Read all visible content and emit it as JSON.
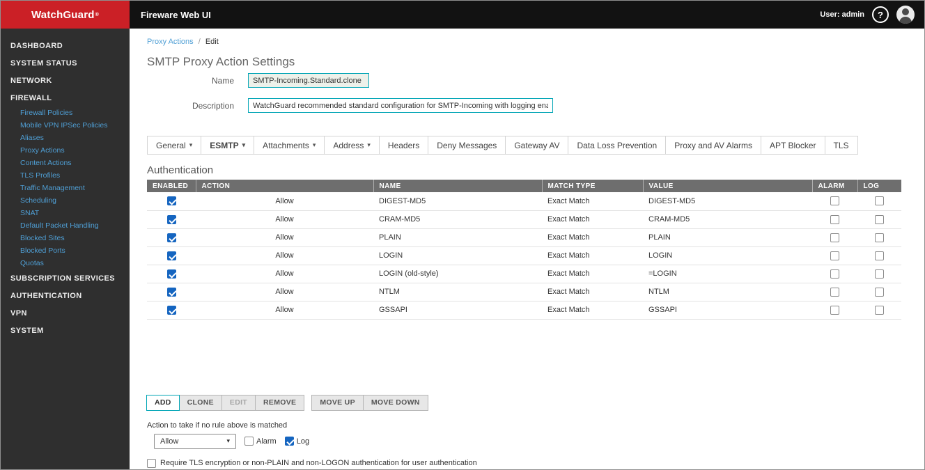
{
  "colors": {
    "brand-red": "#cb2026",
    "topbar-bg": "#121212",
    "sidebar-bg": "#2f2f2f",
    "link-blue": "#4f9fd5",
    "accent": "#00a5b5",
    "table-header-bg": "#6e6e6e",
    "check-blue": "#1565c0"
  },
  "icons": {
    "chevron_down": "▾",
    "help": "?"
  },
  "topbar": {
    "brand": "WatchGuard",
    "brand_reg": "®",
    "title": "Fireware Web UI",
    "user": "User: admin"
  },
  "sidebar": {
    "items": [
      {
        "label": "DASHBOARD"
      },
      {
        "label": "SYSTEM STATUS"
      },
      {
        "label": "NETWORK"
      },
      {
        "label": "FIREWALL",
        "children": [
          "Firewall Policies",
          "Mobile VPN IPSec Policies",
          "Aliases",
          "Proxy Actions",
          "Content Actions",
          "TLS Profiles",
          "Traffic Management",
          "Scheduling",
          "SNAT",
          "Default Packet Handling",
          "Blocked Sites",
          "Blocked Ports",
          "Quotas"
        ]
      },
      {
        "label": "SUBSCRIPTION SERVICES"
      },
      {
        "label": "AUTHENTICATION"
      },
      {
        "label": "VPN"
      },
      {
        "label": "SYSTEM"
      }
    ]
  },
  "breadcrumb": {
    "link": "Proxy Actions",
    "separator": "/",
    "current": "Edit"
  },
  "page": {
    "title": "SMTP Proxy Action Settings",
    "name_label": "Name",
    "name_value": "SMTP-Incoming.Standard.clone",
    "description_label": "Description",
    "description_value": "WatchGuard recommended standard configuration for SMTP-Incoming with logging enabled"
  },
  "tabs": [
    {
      "label": "General",
      "dropdown": true
    },
    {
      "label": "ESMTP",
      "dropdown": true,
      "active": true
    },
    {
      "label": "Attachments",
      "dropdown": true
    },
    {
      "label": "Address",
      "dropdown": true
    },
    {
      "label": "Headers"
    },
    {
      "label": "Deny Messages"
    },
    {
      "label": "Gateway AV"
    },
    {
      "label": "Data Loss Prevention"
    },
    {
      "label": "Proxy and AV Alarms"
    },
    {
      "label": "APT Blocker"
    },
    {
      "label": "TLS"
    }
  ],
  "section": {
    "title": "Authentication"
  },
  "table": {
    "headers": [
      "ENABLED",
      "ACTION",
      "NAME",
      "MATCH TYPE",
      "VALUE",
      "ALARM",
      "LOG"
    ],
    "rows": [
      {
        "enabled": true,
        "action": "Allow",
        "name": "DIGEST-MD5",
        "match_type": "Exact Match",
        "value": "DIGEST-MD5",
        "alarm": false,
        "log": false
      },
      {
        "enabled": true,
        "action": "Allow",
        "name": "CRAM-MD5",
        "match_type": "Exact Match",
        "value": "CRAM-MD5",
        "alarm": false,
        "log": false
      },
      {
        "enabled": true,
        "action": "Allow",
        "name": "PLAIN",
        "match_type": "Exact Match",
        "value": "PLAIN",
        "alarm": false,
        "log": false
      },
      {
        "enabled": true,
        "action": "Allow",
        "name": "LOGIN",
        "match_type": "Exact Match",
        "value": "LOGIN",
        "alarm": false,
        "log": false
      },
      {
        "enabled": true,
        "action": "Allow",
        "name": "LOGIN (old-style)",
        "match_type": "Exact Match",
        "value": "=LOGIN",
        "alarm": false,
        "log": false
      },
      {
        "enabled": true,
        "action": "Allow",
        "name": "NTLM",
        "match_type": "Exact Match",
        "value": "NTLM",
        "alarm": false,
        "log": false
      },
      {
        "enabled": true,
        "action": "Allow",
        "name": "GSSAPI",
        "match_type": "Exact Match",
        "value": "GSSAPI",
        "alarm": false,
        "log": false
      }
    ]
  },
  "buttons": [
    {
      "label": "ADD",
      "primary": true
    },
    {
      "label": "CLONE"
    },
    {
      "label": "EDIT",
      "disabled": true
    },
    {
      "label": "REMOVE"
    },
    {
      "label": "MOVE UP",
      "gap_before": true
    },
    {
      "label": "MOVE DOWN"
    }
  ],
  "footer": {
    "no_rule_text": "Action to take if no rule above is matched",
    "action_value": "Allow",
    "alarm": {
      "label": "Alarm",
      "checked": false
    },
    "log": {
      "label": "Log",
      "checked": true
    },
    "tls_option": {
      "label": "Require TLS encryption or non-PLAIN and non-LOGON authentication for user authentication",
      "checked": false
    }
  }
}
